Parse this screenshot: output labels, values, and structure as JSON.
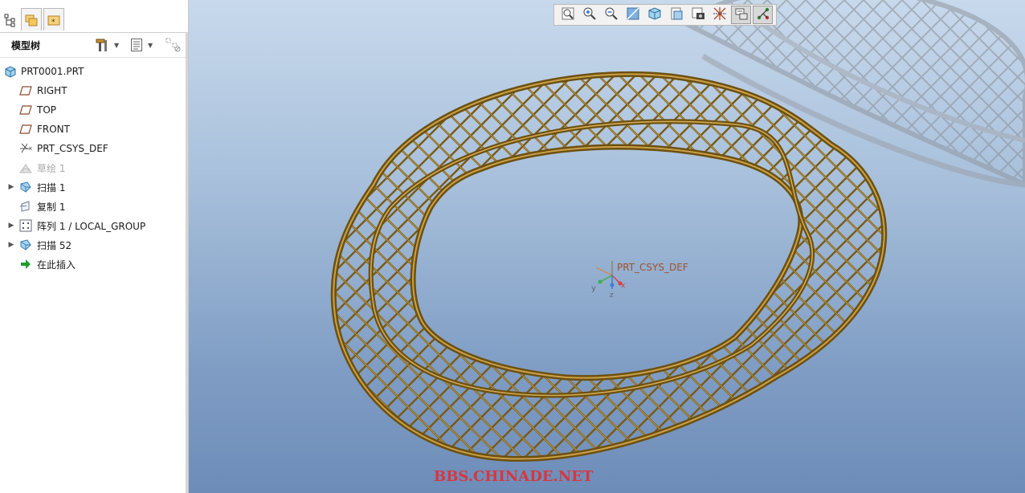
{
  "panel": {
    "tabs": [
      {
        "icon": "model-tree-icon"
      },
      {
        "icon": "folder-browser-icon"
      },
      {
        "icon": "favorites-icon"
      }
    ],
    "title": "模型树",
    "header_buttons": [
      {
        "icon": "tree-settings-icon"
      },
      {
        "icon": "tree-columns-icon"
      },
      {
        "icon": "tree-filter-icon"
      }
    ]
  },
  "tree": {
    "items": [
      {
        "label": "PRT0001.PRT",
        "icon": "part-icon",
        "expandable": false,
        "muted": false
      },
      {
        "label": "RIGHT",
        "icon": "datum-plane-icon",
        "expandable": false,
        "muted": false
      },
      {
        "label": "TOP",
        "icon": "datum-plane-icon",
        "expandable": false,
        "muted": false
      },
      {
        "label": "FRONT",
        "icon": "datum-plane-icon",
        "expandable": false,
        "muted": false
      },
      {
        "label": "PRT_CSYS_DEF",
        "icon": "csys-icon",
        "expandable": false,
        "muted": false
      },
      {
        "label": "草绘 1",
        "icon": "sketch-icon",
        "expandable": false,
        "muted": true
      },
      {
        "label": "扫描 1",
        "icon": "sweep-icon",
        "expandable": true,
        "muted": false
      },
      {
        "label": "复制 1",
        "icon": "copy-icon",
        "expandable": false,
        "muted": false
      },
      {
        "label": "阵列 1 / LOCAL_GROUP",
        "icon": "pattern-icon",
        "expandable": true,
        "muted": false
      },
      {
        "label": "扫描 52",
        "icon": "sweep-icon",
        "expandable": true,
        "muted": false
      },
      {
        "label": "在此插入",
        "icon": "insert-here-icon",
        "expandable": false,
        "muted": false
      }
    ]
  },
  "toolbar": {
    "buttons": [
      {
        "icon": "refit-icon",
        "active": false
      },
      {
        "icon": "zoom-in-icon",
        "active": false
      },
      {
        "icon": "zoom-out-icon",
        "active": false
      },
      {
        "icon": "reorient-icon",
        "active": false
      },
      {
        "icon": "display-style-icon",
        "active": false
      },
      {
        "icon": "saved-views-icon",
        "active": false
      },
      {
        "icon": "view-manager-icon",
        "active": false
      },
      {
        "icon": "datum-display-icon",
        "active": false
      },
      {
        "icon": "annotation-display-icon",
        "active": true
      },
      {
        "icon": "spin-center-icon",
        "active": true
      }
    ]
  },
  "viewport": {
    "csys_label": "PRT_CSYS_DEF",
    "axis_labels": {
      "x": "x",
      "y": "y",
      "z": "z"
    },
    "model_color": "#8a6a1c",
    "watermark": "BBS.CHINADE.NET"
  }
}
